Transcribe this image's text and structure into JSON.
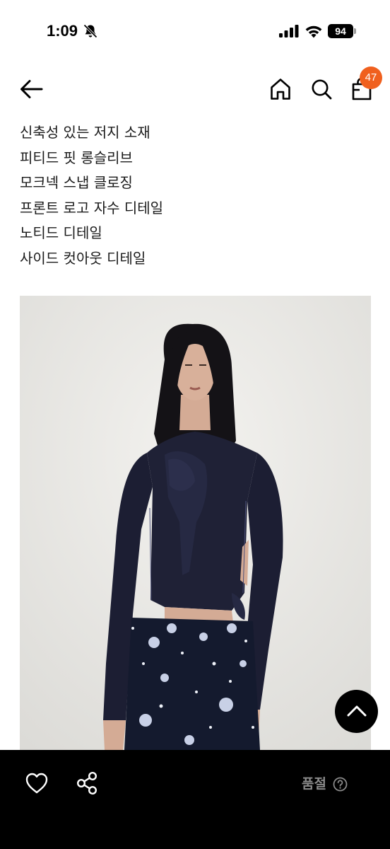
{
  "status_bar": {
    "time": "1:09",
    "battery_level": "94",
    "icons": [
      "bell-slash-icon",
      "cellular-signal-icon",
      "wifi-icon",
      "battery-icon"
    ]
  },
  "header": {
    "icons": [
      "arrow-left-icon",
      "home-icon",
      "search-icon",
      "shopping-bag-icon"
    ],
    "cart_count": "47",
    "badge_color": "#f0601e"
  },
  "description": {
    "lines": [
      "신축성 있는 저지 소재",
      "피티드 핏 롱슬리브",
      "모크넥 스냅 클로징",
      "프론트 로고 자수 디테일",
      "노티드 디테일",
      "사이드 컷아웃 디테일"
    ]
  },
  "scroll_top": {
    "icon": "chevron-up-icon"
  },
  "bottom_bar": {
    "background": "#000000",
    "icons": [
      "heart-icon",
      "share-icon",
      "question-circle-icon"
    ],
    "status_label": "품절",
    "status_color": "#8a8a8a"
  }
}
